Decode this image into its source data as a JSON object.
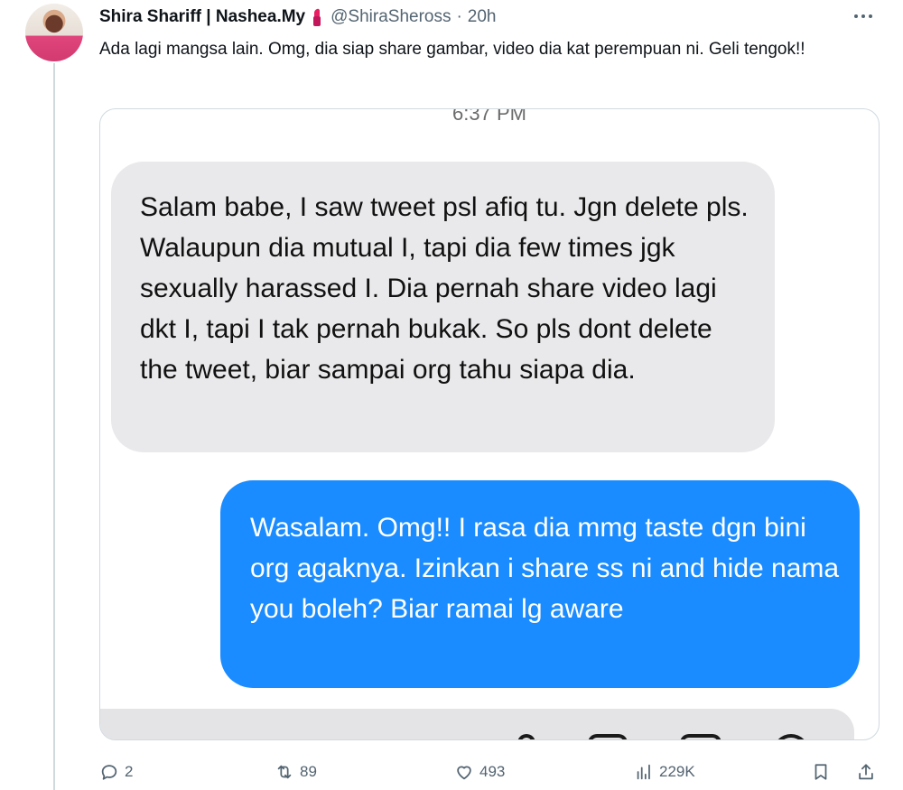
{
  "tweet": {
    "display_name": "Shira Shariff | Nashea.My",
    "name_emoji": "lipstick-icon",
    "handle": "@ShiraSheross",
    "separator": "·",
    "time": "20h",
    "text": "Ada lagi mangsa lain. Omg, dia siap share gambar, video dia kat perempuan ni. Geli tengok!!"
  },
  "screenshot": {
    "time_label": "6:37 PM",
    "received_message": "Salam babe, I saw tweet psl afiq tu. Jgn delete pls. Walaupun dia mutual I, tapi dia few times jgk sexually harassed I. Dia pernah share video lagi dkt I, tapi I tak pernah bukak. So pls dont delete the tweet, biar sampai org tahu siapa dia.",
    "sent_message": "Wasalam. Omg!! I rasa dia mmg taste dgn bini org agaknya. Izinkan i share ss ni and hide nama you boleh? Biar ramai lg aware",
    "colors": {
      "received_bubble": "#e9e9eb",
      "sent_bubble": "#1a8cff"
    }
  },
  "actions": {
    "replies": "2",
    "retweets": "89",
    "likes": "493",
    "views": "229K"
  },
  "icons": [
    "reply-icon",
    "retweet-icon",
    "like-icon",
    "views-icon",
    "bookmark-icon",
    "share-icon",
    "more-icon"
  ]
}
